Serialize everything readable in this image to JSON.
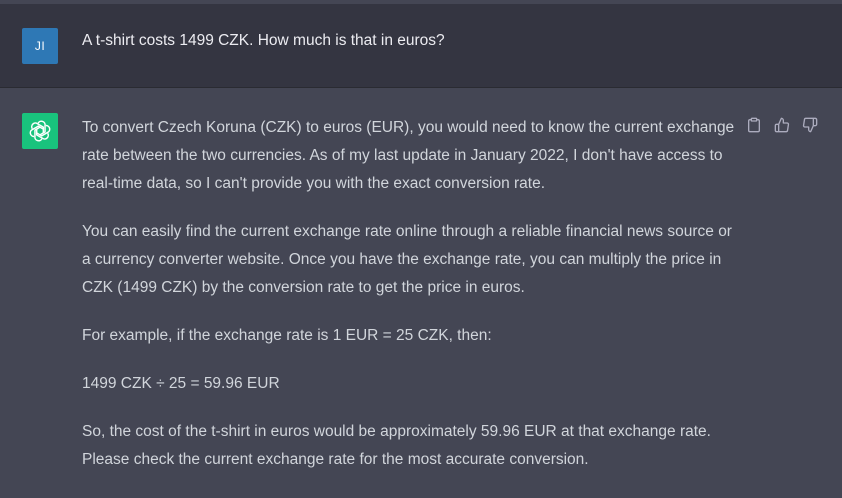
{
  "user_message": {
    "avatar_initials": "JI",
    "avatar_color": "#2e78b5",
    "text": "A t-shirt costs 1499 CZK. How much is that in euros?"
  },
  "assistant_message": {
    "avatar_icon": "openai-logo-icon",
    "avatar_color": "#19c37d",
    "paragraphs": [
      "To convert Czech Koruna (CZK) to euros (EUR), you would need to know the current exchange rate between the two currencies. As of my last update in January 2022, I don't have access to real-time data, so I can't provide you with the exact conversion rate.",
      "You can easily find the current exchange rate online through a reliable financial news source or a currency converter website. Once you have the exchange rate, you can multiply the price in CZK (1499 CZK) by the conversion rate to get the price in euros.",
      "For example, if the exchange rate is 1 EUR = 25 CZK, then:",
      "1499 CZK ÷ 25 = 59.96 EUR",
      "So, the cost of the t-shirt in euros would be approximately 59.96 EUR at that exchange rate. Please check the current exchange rate for the most accurate conversion."
    ],
    "actions": [
      "copy-icon",
      "thumbs-up-icon",
      "thumbs-down-icon"
    ]
  },
  "colors": {
    "user_bg": "#343541",
    "assistant_bg": "#444654",
    "text_user": "#ececf1",
    "text_assistant": "#d1d5db",
    "icon": "#acacbe"
  }
}
